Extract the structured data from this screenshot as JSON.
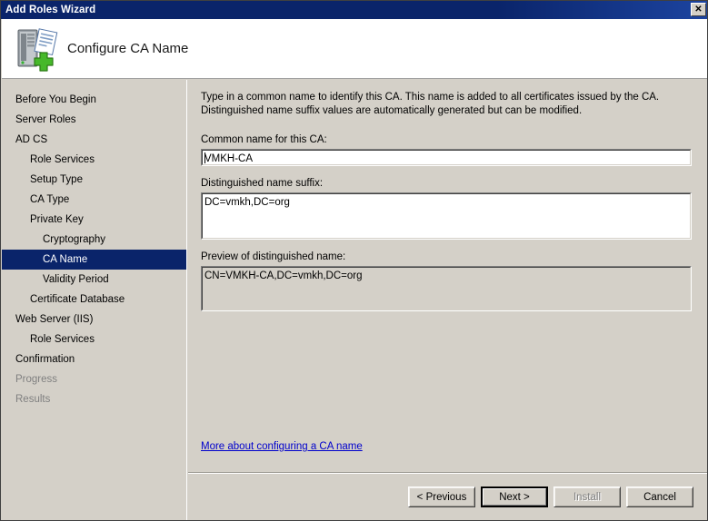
{
  "window": {
    "title": "Add Roles Wizard",
    "close_button": "✕",
    "close_icon_name": "close-icon"
  },
  "header": {
    "title": "Configure CA Name",
    "icon": "server-certificate-add-icon"
  },
  "sidebar": {
    "items": [
      {
        "label": "Before You Begin",
        "level": 0,
        "state": "normal"
      },
      {
        "label": "Server Roles",
        "level": 0,
        "state": "normal"
      },
      {
        "label": "AD CS",
        "level": 0,
        "state": "normal"
      },
      {
        "label": "Role Services",
        "level": 1,
        "state": "normal"
      },
      {
        "label": "Setup Type",
        "level": 1,
        "state": "normal"
      },
      {
        "label": "CA Type",
        "level": 1,
        "state": "normal"
      },
      {
        "label": "Private Key",
        "level": 1,
        "state": "normal"
      },
      {
        "label": "Cryptography",
        "level": 2,
        "state": "normal"
      },
      {
        "label": "CA Name",
        "level": 2,
        "state": "selected"
      },
      {
        "label": "Validity Period",
        "level": 2,
        "state": "normal"
      },
      {
        "label": "Certificate Database",
        "level": 1,
        "state": "normal"
      },
      {
        "label": "Web Server (IIS)",
        "level": 0,
        "state": "normal"
      },
      {
        "label": "Role Services",
        "level": 1,
        "state": "normal"
      },
      {
        "label": "Confirmation",
        "level": 0,
        "state": "normal"
      },
      {
        "label": "Progress",
        "level": 0,
        "state": "disabled"
      },
      {
        "label": "Results",
        "level": 0,
        "state": "disabled"
      }
    ]
  },
  "main": {
    "intro_line1": "Type in a common name to identify this CA. This name is added to all certificates issued by the CA.",
    "intro_line2": "Distinguished name suffix values are automatically generated but can be modified.",
    "common_name_label": "Common name for this CA:",
    "common_name_value": "VMKH-CA",
    "suffix_label": "Distinguished name suffix:",
    "suffix_value": "DC=vmkh,DC=org",
    "preview_label": "Preview of distinguished name:",
    "preview_value": "CN=VMKH-CA,DC=vmkh,DC=org",
    "help_link": "More about configuring a CA name"
  },
  "buttons": {
    "previous": "< Previous",
    "next": "Next >",
    "install": "Install",
    "cancel": "Cancel"
  },
  "colors": {
    "titlebar": "#0a246a",
    "face": "#d4d0c8",
    "selection": "#0a246a",
    "link": "#0000cc",
    "disabled_text": "#808080"
  }
}
